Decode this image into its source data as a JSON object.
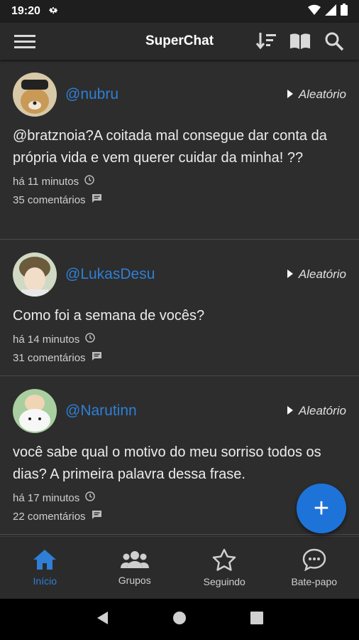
{
  "status_bar": {
    "time": "19:20"
  },
  "app": {
    "title": "SuperChat"
  },
  "posts": [
    {
      "username": "@nubru",
      "category": "Aleatório",
      "text": "@bratznoia?A coitada mal consegue dar conta da própria vida e vem querer cuidar da minha! ??",
      "time": "há 11 minutos",
      "comments": "35 comentários"
    },
    {
      "username": "@LukasDesu",
      "category": "Aleatório",
      "text": "Como foi a semana de vocês?",
      "time": "há 14 minutos",
      "comments": "31 comentários"
    },
    {
      "username": "@Narutinn",
      "category": "Aleatório",
      "text": "você sabe qual o motivo do meu sorriso todos os dias? A primeira palavra dessa frase.",
      "time": "há 17 minutos",
      "comments": "22 comentários"
    }
  ],
  "fab": {
    "label": "+"
  },
  "bottom_nav": [
    {
      "label": "Início",
      "icon": "home-icon",
      "active": true
    },
    {
      "label": "Grupos",
      "icon": "group-icon",
      "active": false
    },
    {
      "label": "Seguindo",
      "icon": "star-icon",
      "active": false
    },
    {
      "label": "Bate-papo",
      "icon": "chat-icon",
      "active": false
    }
  ],
  "colors": {
    "accent": "#2f7fd6",
    "fab": "#1e73d9",
    "background": "#2d2d2d"
  }
}
